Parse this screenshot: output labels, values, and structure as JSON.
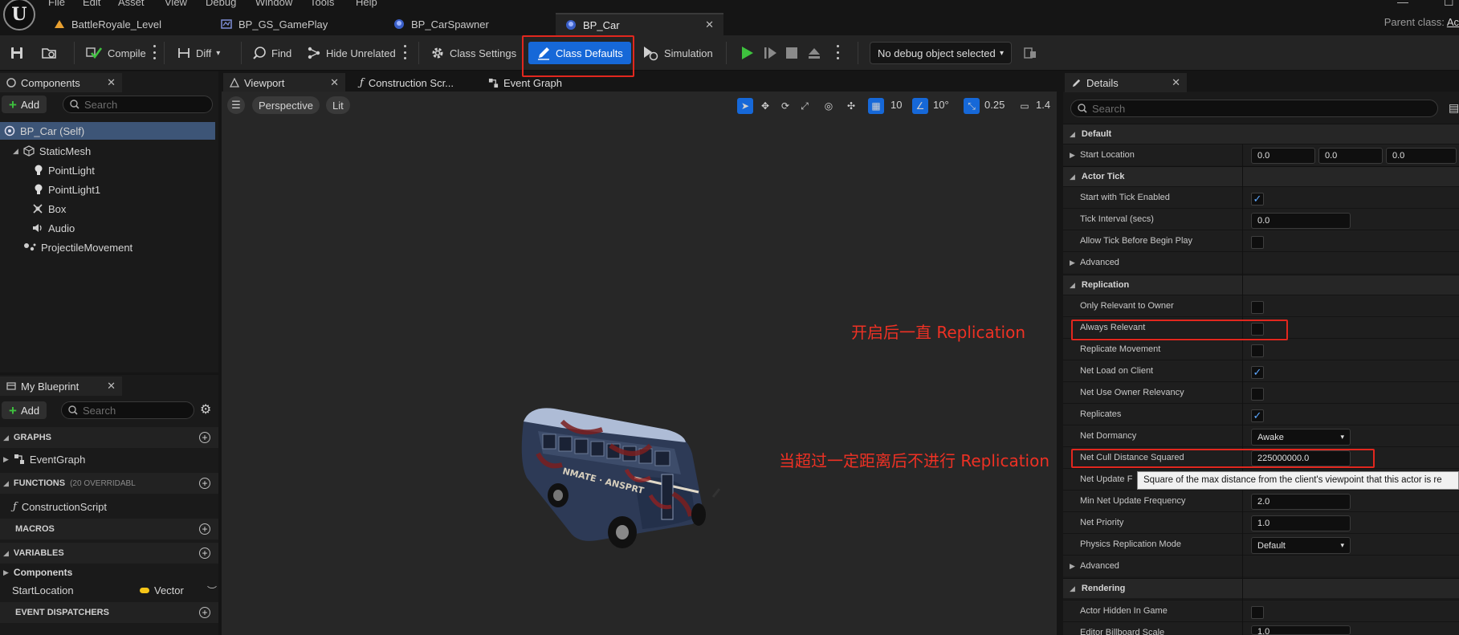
{
  "menu": [
    "File",
    "Edit",
    "Asset",
    "View",
    "Debug",
    "Window",
    "Tools",
    "Help"
  ],
  "logo_text": "U",
  "doc_tabs": [
    {
      "label": "BattleRoyale_Level",
      "icon": "level-icon"
    },
    {
      "label": "BP_GS_GamePlay",
      "icon": "graph-icon"
    },
    {
      "label": "BP_CarSpawner",
      "icon": "blueprint-icon"
    },
    {
      "label": "BP_Car",
      "icon": "blueprint-icon",
      "active": true
    }
  ],
  "parent_class": {
    "label": "Parent class:",
    "value": "Ac"
  },
  "toolbar": {
    "compile": "Compile",
    "diff": "Diff",
    "find": "Find",
    "hide_unrelated": "Hide Unrelated",
    "class_settings": "Class Settings",
    "class_defaults": "Class Defaults",
    "simulation": "Simulation",
    "debug_object": "No debug object selected"
  },
  "components": {
    "tab_label": "Components",
    "add_label": "Add",
    "search_placeholder": "Search",
    "items": [
      {
        "label": "BP_Car (Self)",
        "icon": "self-icon"
      },
      {
        "label": "StaticMesh",
        "icon": "static-mesh-icon"
      },
      {
        "label": "PointLight",
        "icon": "point-light-icon"
      },
      {
        "label": "PointLight1",
        "icon": "point-light-icon"
      },
      {
        "label": "Box",
        "icon": "box-collision-icon"
      },
      {
        "label": "Audio",
        "icon": "audio-icon"
      },
      {
        "label": "ProjectileMovement",
        "icon": "movement-icon"
      }
    ]
  },
  "my_blueprint": {
    "tab_label": "My Blueprint",
    "add_label": "Add",
    "search_placeholder": "Search",
    "graphs_header": "GRAPHS",
    "event_graph": "EventGraph",
    "functions_header": "FUNCTIONS",
    "functions_note": "(20 OVERRIDABL",
    "construction_script": "ConstructionScript",
    "macros_header": "MACROS",
    "variables_header": "VARIABLES",
    "components_category": "Components",
    "variable_name": "StartLocation",
    "variable_type": "Vector",
    "event_dispatchers_header": "EVENT DISPATCHERS"
  },
  "editor_tabs": {
    "viewport": "Viewport",
    "construction_script": "Construction Scr...",
    "event_graph": "Event Graph"
  },
  "viewport": {
    "perspective": "Perspective",
    "lit": "Lit",
    "grid_snap": "10",
    "rotation_snap": "10°",
    "scale_snap": "0.25",
    "camera_speed": "1.4"
  },
  "details": {
    "tab_label": "Details",
    "search_placeholder": "Search",
    "sections": {
      "default": "Default",
      "actor_tick": "Actor Tick",
      "replication": "Replication",
      "rendering": "Rendering"
    },
    "start_location": {
      "label": "Start Location",
      "x": "0.0",
      "y": "0.0",
      "z": "0.0"
    },
    "start_with_tick": {
      "label": "Start with Tick Enabled",
      "checked": true
    },
    "tick_interval": {
      "label": "Tick Interval (secs)",
      "value": "0.0"
    },
    "allow_tick": {
      "label": "Allow Tick Before Begin Play",
      "checked": false
    },
    "advanced": "Advanced",
    "only_relevant_owner": {
      "label": "Only Relevant to Owner",
      "checked": false
    },
    "always_relevant": {
      "label": "Always Relevant",
      "checked": false
    },
    "replicate_movement": {
      "label": "Replicate Movement",
      "checked": false
    },
    "net_load_client": {
      "label": "Net Load on Client",
      "checked": true
    },
    "net_use_owner": {
      "label": "Net Use Owner Relevancy",
      "checked": false
    },
    "replicates": {
      "label": "Replicates",
      "checked": true
    },
    "net_dormancy": {
      "label": "Net Dormancy",
      "value": "Awake"
    },
    "net_cull": {
      "label": "Net Cull Distance Squared",
      "value": "225000000.0"
    },
    "net_update_freq": {
      "label": "Net Update F"
    },
    "min_net_update": {
      "label": "Min Net Update Frequency",
      "value": "2.0"
    },
    "net_priority": {
      "label": "Net Priority",
      "value": "1.0"
    },
    "physics_rep_mode": {
      "label": "Physics Replication Mode",
      "value": "Default"
    },
    "actor_hidden": {
      "label": "Actor Hidden In Game",
      "checked": false
    },
    "billboard_scale": {
      "label": "Editor Billboard Scale",
      "value": "1.0"
    }
  },
  "tooltip": "Square of the max distance from the client's viewpoint that this actor is re",
  "annotations": {
    "always_relevant": "开启后一直 Replication",
    "net_cull": "当超过一定距离后不进行 Replication"
  },
  "colors": {
    "accent_blue": "#1668d8",
    "annotation_red": "#e1271e",
    "play_green": "#3ec23e",
    "checkbox_blue": "#5ea8ff"
  }
}
